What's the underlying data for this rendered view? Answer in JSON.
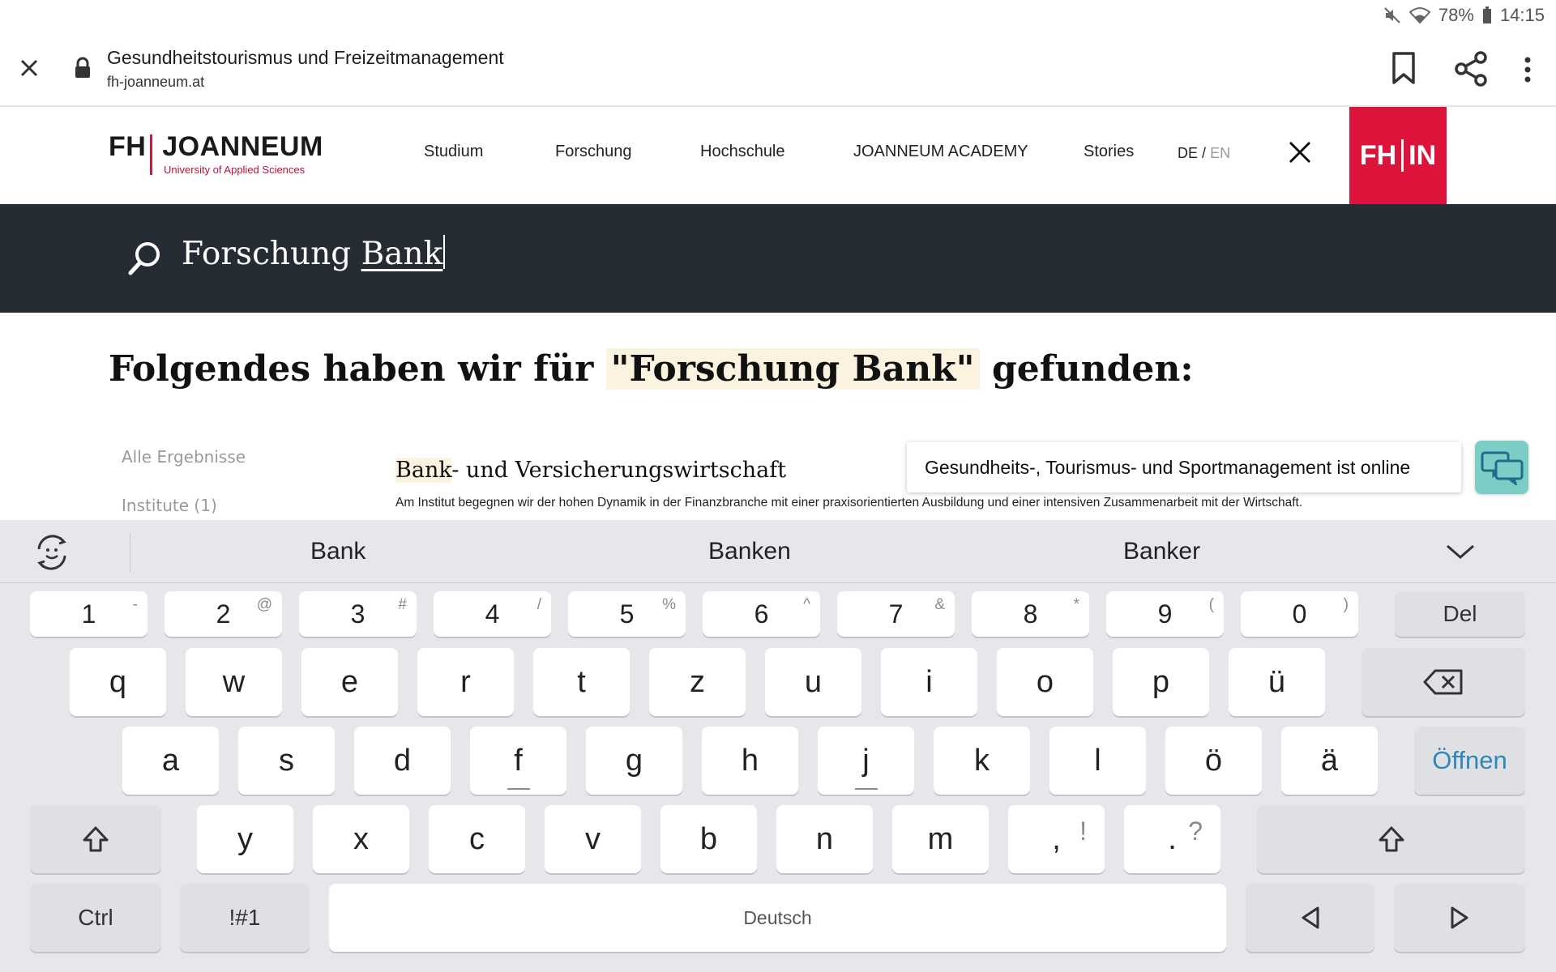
{
  "status": {
    "battery": "78%",
    "time": "14:15"
  },
  "browser": {
    "title": "Gesundheitstourismus und Freizeitmanagement",
    "url": "fh-joanneum.at"
  },
  "site": {
    "logo_main": "FH JOANNEUM",
    "logo_left": "FH",
    "logo_right": "JOANNEUM",
    "logo_sub": "University of Applied Sciences",
    "nav": [
      "Studium",
      "Forschung",
      "Hochschule",
      "JOANNEUM ACADEMY",
      "Stories"
    ],
    "lang_de": "DE",
    "lang_sep": "/",
    "lang_en": "EN",
    "fhin_left": "FH",
    "fhin_right": "IN",
    "brand_color": "#dc143c"
  },
  "search": {
    "word1": "Forschung",
    "word2": "Bank",
    "value": "Forschung Bank"
  },
  "results": {
    "heading_pre": "Folgendes haben wir für",
    "heading_query": "\"Forschung Bank\"",
    "heading_post": "gefunden:",
    "filters": [
      "Alle Ergebnisse",
      "Institute (1)"
    ],
    "item_title_hl": "Bank",
    "item_title_rest": "- und Versicherungswirtschaft",
    "item_desc": "Am Institut begegnen wir der hohen Dynamik in der Finanzbranche mit einer praxisorientierten Ausbildung und einer intensiven Zusammenarbeit mit der Wirtschaft."
  },
  "toast": {
    "text": "Gesundheits-, Tourismus- und Sportmanagement ist online"
  },
  "keyboard": {
    "suggestions": [
      "Bank",
      "Banken",
      "Banker"
    ],
    "num_row": [
      {
        "main": "1",
        "sub": "-"
      },
      {
        "main": "2",
        "sub": "@"
      },
      {
        "main": "3",
        "sub": "#"
      },
      {
        "main": "4",
        "sub": "/"
      },
      {
        "main": "5",
        "sub": "%"
      },
      {
        "main": "6",
        "sub": "^"
      },
      {
        "main": "7",
        "sub": "&"
      },
      {
        "main": "8",
        "sub": "*"
      },
      {
        "main": "9",
        "sub": "("
      },
      {
        "main": "0",
        "sub": ")"
      }
    ],
    "del": "Del",
    "row1": [
      "q",
      "w",
      "e",
      "r",
      "t",
      "z",
      "u",
      "i",
      "o",
      "p",
      "ü"
    ],
    "row2": [
      "a",
      "s",
      "d",
      "f",
      "g",
      "h",
      "j",
      "k",
      "l",
      "ö",
      "ä"
    ],
    "open": "Öffnen",
    "row3": [
      {
        "main": "y",
        "sub": ""
      },
      {
        "main": "x",
        "sub": ""
      },
      {
        "main": "c",
        "sub": ""
      },
      {
        "main": "v",
        "sub": ""
      },
      {
        "main": "b",
        "sub": ""
      },
      {
        "main": "n",
        "sub": ""
      },
      {
        "main": "m",
        "sub": ""
      },
      {
        "main": ",",
        "sub": "!"
      },
      {
        "main": ".",
        "sub": "?"
      }
    ],
    "ctrl": "Ctrl",
    "sym": "!#1",
    "space": "Deutsch"
  }
}
